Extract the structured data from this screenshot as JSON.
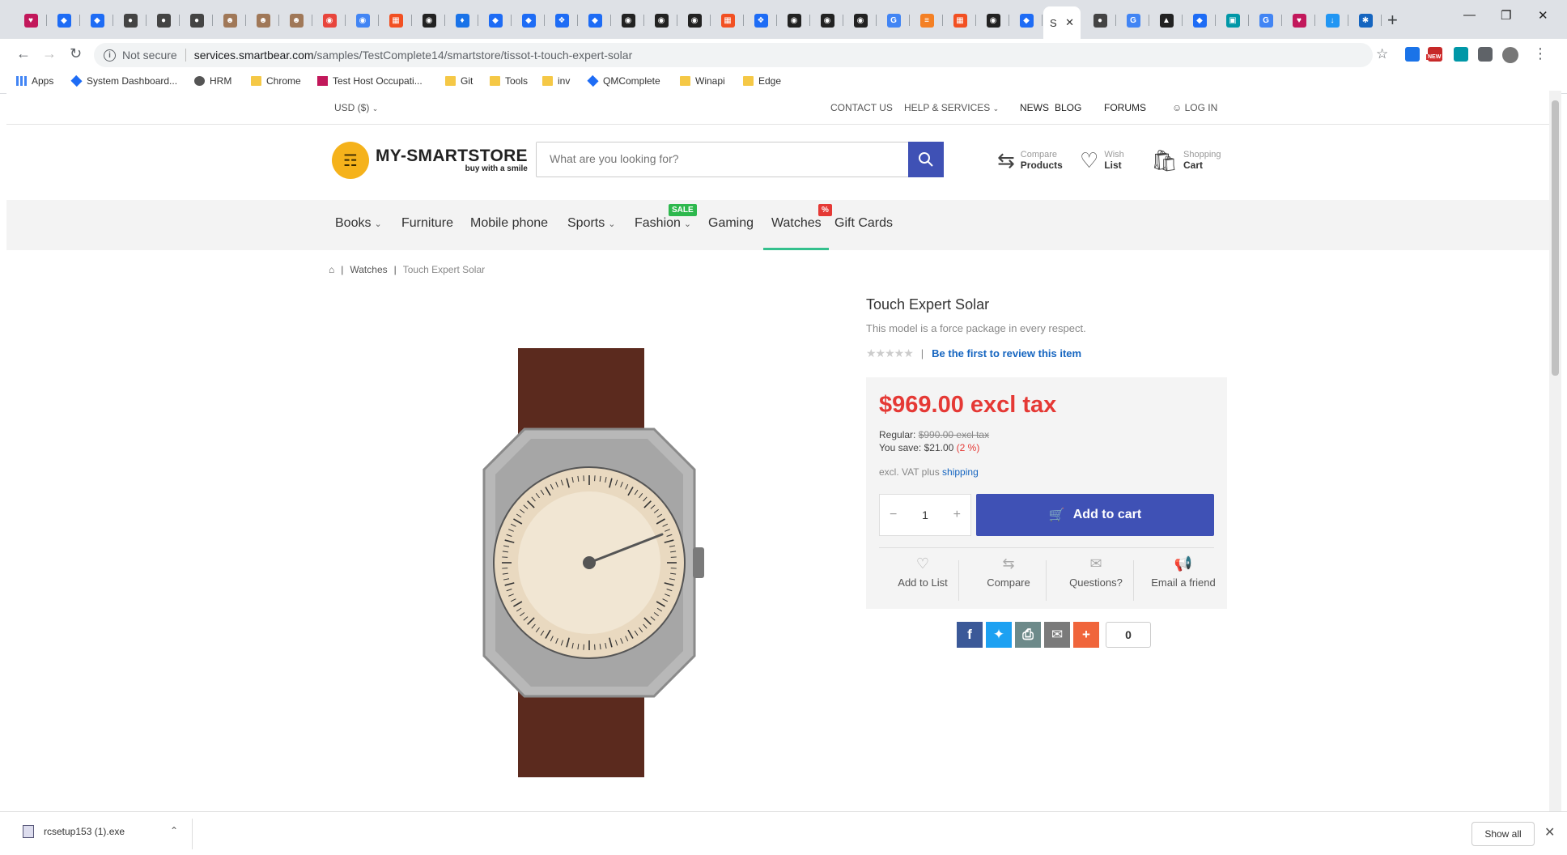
{
  "browser": {
    "tabs": [
      {
        "icon": "mixed-icon",
        "color": "#c2185b"
      },
      {
        "icon": "jira-icon",
        "color": "#1e6cf5"
      },
      {
        "icon": "jira-icon",
        "color": "#1e6cf5"
      },
      {
        "icon": "globe-icon",
        "color": "#444"
      },
      {
        "icon": "globe-icon",
        "color": "#444"
      },
      {
        "icon": "globe-icon",
        "color": "#444"
      },
      {
        "icon": "avatar-icon",
        "color": "#a07858"
      },
      {
        "icon": "avatar-icon",
        "color": "#a07858"
      },
      {
        "icon": "avatar-icon",
        "color": "#a07858"
      },
      {
        "icon": "chrome-icon",
        "color": "#e8453c"
      },
      {
        "icon": "chrome-icon",
        "color": "#4285f4"
      },
      {
        "icon": "microsoft-icon",
        "color": "#f25022"
      },
      {
        "icon": "github-icon",
        "color": "#222"
      },
      {
        "icon": "translate-icon",
        "color": "#1a73e8"
      },
      {
        "icon": "jira-icon",
        "color": "#1e6cf5"
      },
      {
        "icon": "jira-icon",
        "color": "#1e6cf5"
      },
      {
        "icon": "qmcomplete-icon",
        "color": "#1e6cf5"
      },
      {
        "icon": "jira-icon",
        "color": "#1e6cf5"
      },
      {
        "icon": "github-icon",
        "color": "#222"
      },
      {
        "icon": "github-icon",
        "color": "#222"
      },
      {
        "icon": "github-icon",
        "color": "#222"
      },
      {
        "icon": "microsoft-icon",
        "color": "#f25022"
      },
      {
        "icon": "qmcomplete-icon",
        "color": "#1e6cf5"
      },
      {
        "icon": "github-icon",
        "color": "#222"
      },
      {
        "icon": "github-icon",
        "color": "#222"
      },
      {
        "icon": "github-icon",
        "color": "#222"
      },
      {
        "icon": "google-icon",
        "color": "#4285f4"
      },
      {
        "icon": "stackoverflow-icon",
        "color": "#f48024"
      },
      {
        "icon": "microsoft-icon",
        "color": "#f25022"
      },
      {
        "icon": "github-icon",
        "color": "#222"
      },
      {
        "icon": "jira-icon",
        "color": "#1e6cf5"
      }
    ],
    "active_tab_label": "S",
    "tabs_after": [
      {
        "icon": "globe-icon",
        "color": "#444"
      },
      {
        "icon": "google-icon",
        "color": "#4285f4"
      },
      {
        "icon": "hat-icon",
        "color": "#222"
      },
      {
        "icon": "jira-icon",
        "color": "#1e6cf5"
      },
      {
        "icon": "qr-icon",
        "color": "#0097a7"
      },
      {
        "icon": "google-icon",
        "color": "#4285f4"
      },
      {
        "icon": "mixed-icon",
        "color": "#c2185b"
      },
      {
        "icon": "download-icon",
        "color": "#2196f3"
      },
      {
        "icon": "puzzle-icon",
        "color": "#1565c0"
      }
    ],
    "address": {
      "security": "Not secure",
      "host": "services.smartbear.com",
      "path": "/samples/TestComplete14/smartstore/tissot-t-touch-expert-solar"
    },
    "bookmarks": [
      {
        "label": "Apps",
        "icon": "apps-icon"
      },
      {
        "label": "System Dashboard...",
        "icon": "jira-icon"
      },
      {
        "label": "HRM",
        "icon": "globe-icon"
      },
      {
        "label": "Chrome",
        "icon": "folder-icon"
      },
      {
        "label": "Test Host Occupati...",
        "icon": "mixed-icon"
      },
      {
        "label": "Git",
        "icon": "folder-icon"
      },
      {
        "label": "Tools",
        "icon": "folder-icon"
      },
      {
        "label": "inv",
        "icon": "folder-icon"
      },
      {
        "label": "QMComplete",
        "icon": "qmcomplete-icon"
      },
      {
        "label": "Winapi",
        "icon": "folder-icon"
      },
      {
        "label": "Edge",
        "icon": "folder-icon"
      }
    ],
    "extension_badge": "NEW"
  },
  "store": {
    "topbar": {
      "currency": "USD  ($)",
      "contact": "CONTACT US",
      "help": "HELP & SERVICES",
      "news": "NEWS",
      "blog": "BLOG",
      "forums": "FORUMS",
      "login": "LOG IN"
    },
    "logo": {
      "name": "MY-SMARTSTORE",
      "tagline": "buy with a smile"
    },
    "search_placeholder": "What are you looking for?",
    "header_links": [
      {
        "top": "Compare",
        "bottom": "Products",
        "icon": "compare-icon"
      },
      {
        "top": "Wish",
        "bottom": "List",
        "icon": "heart-icon"
      },
      {
        "top": "Shopping",
        "bottom": "Cart",
        "icon": "bag-icon"
      }
    ],
    "menu": [
      {
        "label": "Books",
        "dropdown": true
      },
      {
        "label": "Furniture",
        "dropdown": false
      },
      {
        "label": "Mobile phone",
        "dropdown": false
      },
      {
        "label": "Sports",
        "dropdown": true
      },
      {
        "label": "Fashion",
        "dropdown": true,
        "badge": "SALE",
        "badge_color": "#2db84d"
      },
      {
        "label": "Gaming",
        "dropdown": false
      },
      {
        "label": "Watches",
        "dropdown": false,
        "badge": "%",
        "badge_color": "#e53935",
        "active": true
      },
      {
        "label": "Gift Cards",
        "dropdown": false
      }
    ],
    "breadcrumb": {
      "category": "Watches",
      "current": "Touch Expert Solar"
    },
    "product": {
      "title": "Touch Expert Solar",
      "short_description": "This model is a force package in every respect.",
      "review_link": "Be the first to review this item",
      "price": "$969.00 excl tax",
      "regular_label": "Regular:",
      "regular_price": "$990.00 excl tax",
      "save_label": "You save: $21.00",
      "save_pct": "(2 %)",
      "vat_text": "excl. VAT plus",
      "shipping_link": "shipping",
      "quantity": "1",
      "add_to_cart": "Add to cart",
      "actions": [
        "Add to List",
        "Compare",
        "Questions?",
        "Email a friend"
      ],
      "share_count": "0"
    }
  },
  "download": {
    "file": "rcsetup153 (1).exe",
    "show_all": "Show all"
  }
}
